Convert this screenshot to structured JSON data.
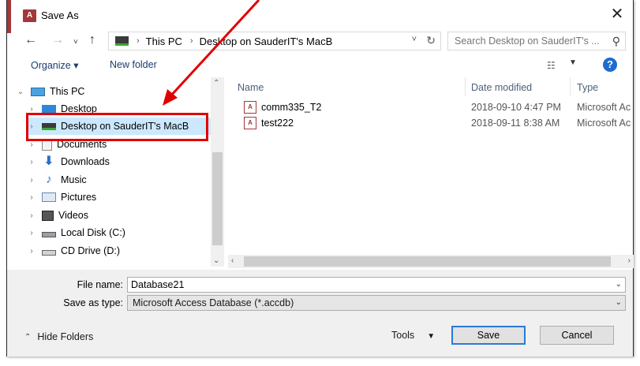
{
  "window": {
    "title": "Save As",
    "app_icon_text": "A"
  },
  "navigation": {
    "address_segments": [
      "This PC",
      "Desktop on SauderIT's MacB"
    ],
    "search_placeholder": "Search Desktop on SauderIT's ..."
  },
  "toolbar": {
    "organize_label": "Organize ▾",
    "new_folder_label": "New folder",
    "help_label": "?"
  },
  "sidebar": {
    "items": [
      {
        "label": "This PC",
        "icon": "pc-icon",
        "expanded": true
      },
      {
        "label": "Desktop",
        "icon": "desktop-icon"
      },
      {
        "label": "Desktop on SauderIT's MacB",
        "icon": "network-drive-icon",
        "selected": true
      },
      {
        "label": "Documents",
        "icon": "documents-icon"
      },
      {
        "label": "Downloads",
        "icon": "downloads-icon"
      },
      {
        "label": "Music",
        "icon": "music-icon"
      },
      {
        "label": "Pictures",
        "icon": "pictures-icon"
      },
      {
        "label": "Videos",
        "icon": "videos-icon"
      },
      {
        "label": "Local Disk (C:)",
        "icon": "local-disk-icon"
      },
      {
        "label": "CD Drive (D:)",
        "icon": "cd-drive-icon"
      }
    ]
  },
  "file_list": {
    "columns": [
      "Name",
      "Date modified",
      "Type"
    ],
    "rows": [
      {
        "name": "comm335_T2",
        "date": "2018-09-10 4:47 PM",
        "type": "Microsoft Ac"
      },
      {
        "name": "test222",
        "date": "2018-09-11 8:38 AM",
        "type": "Microsoft Ac"
      }
    ]
  },
  "form": {
    "file_name_label": "File name:",
    "file_name_value": "Database21",
    "save_type_label": "Save as type:",
    "save_type_value": "Microsoft Access Database (*.accdb)"
  },
  "footer": {
    "hide_folders_label": "Hide Folders",
    "tools_label": "Tools",
    "save_label": "Save",
    "cancel_label": "Cancel"
  },
  "colors": {
    "accent": "#a4373a",
    "highlight": "#e00000",
    "selection": "#cce8ff",
    "primary_button_border": "#2a7ad8"
  }
}
